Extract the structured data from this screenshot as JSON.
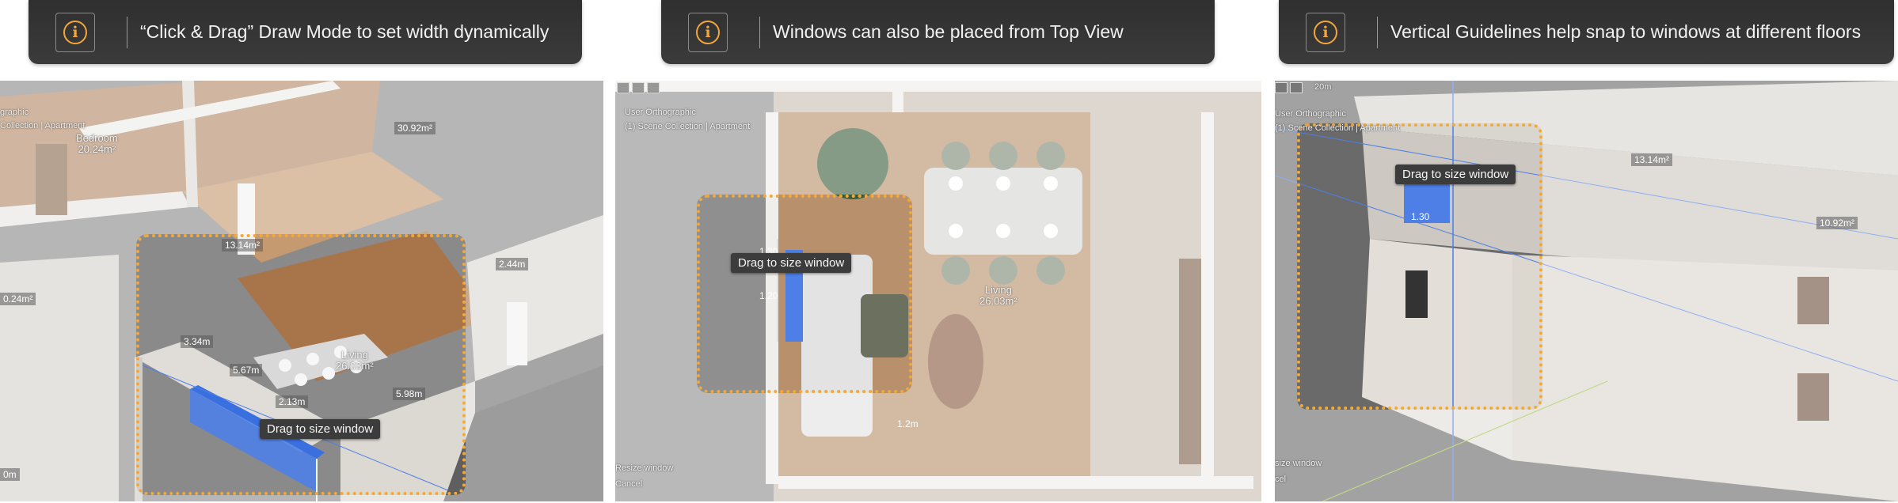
{
  "callouts": [
    {
      "text": "“Click & Drag” Draw Mode to set width dynamically"
    },
    {
      "text": "Windows can also be placed from Top View"
    },
    {
      "text": "Vertical Guidelines help snap to windows at different floors"
    }
  ],
  "info_glyph": "i",
  "tooltip": "Drag to size window",
  "panel1": {
    "hud_view": "graphic",
    "hud_collection": "Collection | Apartment",
    "rooms": [
      {
        "name": "Bedroom",
        "area": "20.24m²"
      },
      {
        "name": "Living",
        "area": "26.03m²"
      }
    ],
    "area_tags": [
      "30.92m²",
      "13.14m²",
      "2.44m",
      "0.24m²",
      "5.67m",
      "2.13m",
      "3.34m",
      "5.98m",
      "0m"
    ]
  },
  "panel2": {
    "hud_view": "User Orthographic",
    "hud_collection": "(1) Scene Collection | Apartment",
    "room": {
      "name": "Living",
      "area": "26.03m²"
    },
    "dims": [
      "1.30",
      "1.20"
    ],
    "footer": [
      "Resize window",
      "Cancel"
    ],
    "tag_bottom": "1.2m"
  },
  "panel3": {
    "hud_view": "User Orthographic",
    "hud_collection": "(1) Scene Collection | Apartment",
    "hud_scale": "20m",
    "area_tags": [
      "13.14m²",
      "10.92m²",
      "1.30"
    ],
    "footer": [
      "size window",
      "cel"
    ]
  },
  "colors": {
    "accent_orange": "#f2a93b",
    "window_blue": "#4d7fe6",
    "callout_bg": "#333333"
  }
}
